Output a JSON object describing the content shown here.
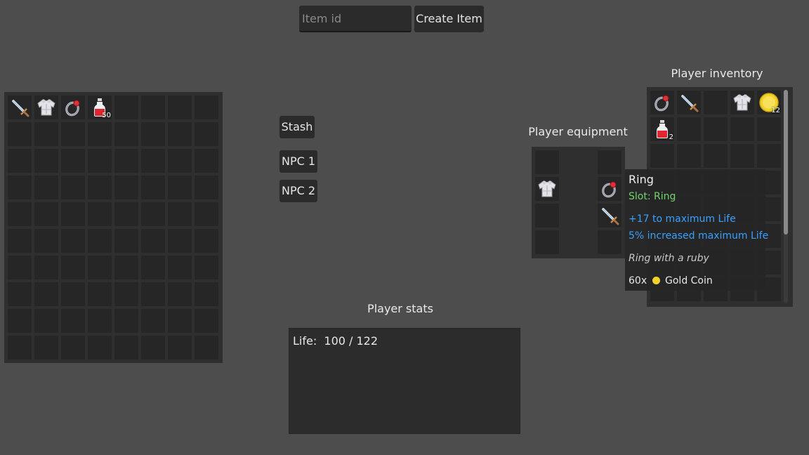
{
  "create": {
    "placeholder": "Item id",
    "button_label": "Create Item"
  },
  "stash_buttons": [
    "Stash",
    "NPC 1",
    "NPC 2"
  ],
  "titles": {
    "player_inventory": "Player inventory",
    "player_equipment": "Player equipment",
    "player_stats": "Player stats"
  },
  "stash": {
    "items": [
      {
        "slot": 0,
        "icon": "sword-icon"
      },
      {
        "slot": 1,
        "icon": "armor-icon"
      },
      {
        "slot": 2,
        "icon": "ring-icon"
      },
      {
        "slot": 3,
        "icon": "potion-icon",
        "count": "50"
      }
    ]
  },
  "inventory": {
    "items": [
      {
        "slot": 0,
        "icon": "ring-icon"
      },
      {
        "slot": 1,
        "icon": "sword-icon"
      },
      {
        "slot": 3,
        "icon": "armor-icon"
      },
      {
        "slot": 4,
        "icon": "gold-coin-icon",
        "count": "12"
      },
      {
        "slot": 5,
        "icon": "potion-icon",
        "count": "2"
      }
    ]
  },
  "equipment": {
    "slots": [
      {
        "icon": null
      },
      {
        "icon": null
      },
      {
        "icon": "armor-icon"
      },
      {
        "icon": "ring-icon"
      },
      {
        "icon": null
      },
      {
        "icon": "sword-icon"
      },
      {
        "icon": null
      },
      {
        "icon": null
      }
    ]
  },
  "tooltip": {
    "name": "Ring",
    "slot": "Slot: Ring",
    "mods": [
      "+17 to maximum Life",
      "5% increased maximum Life"
    ],
    "flavor": "Ring with a ruby",
    "price_qty": "60x",
    "price_currency": "Gold Coin",
    "colors": {
      "slot": "#6fd46f",
      "mods": "#3aa0ff",
      "flavor": "#c8c8c8"
    }
  },
  "stats": {
    "life_label": "Life:  100 / 122"
  }
}
